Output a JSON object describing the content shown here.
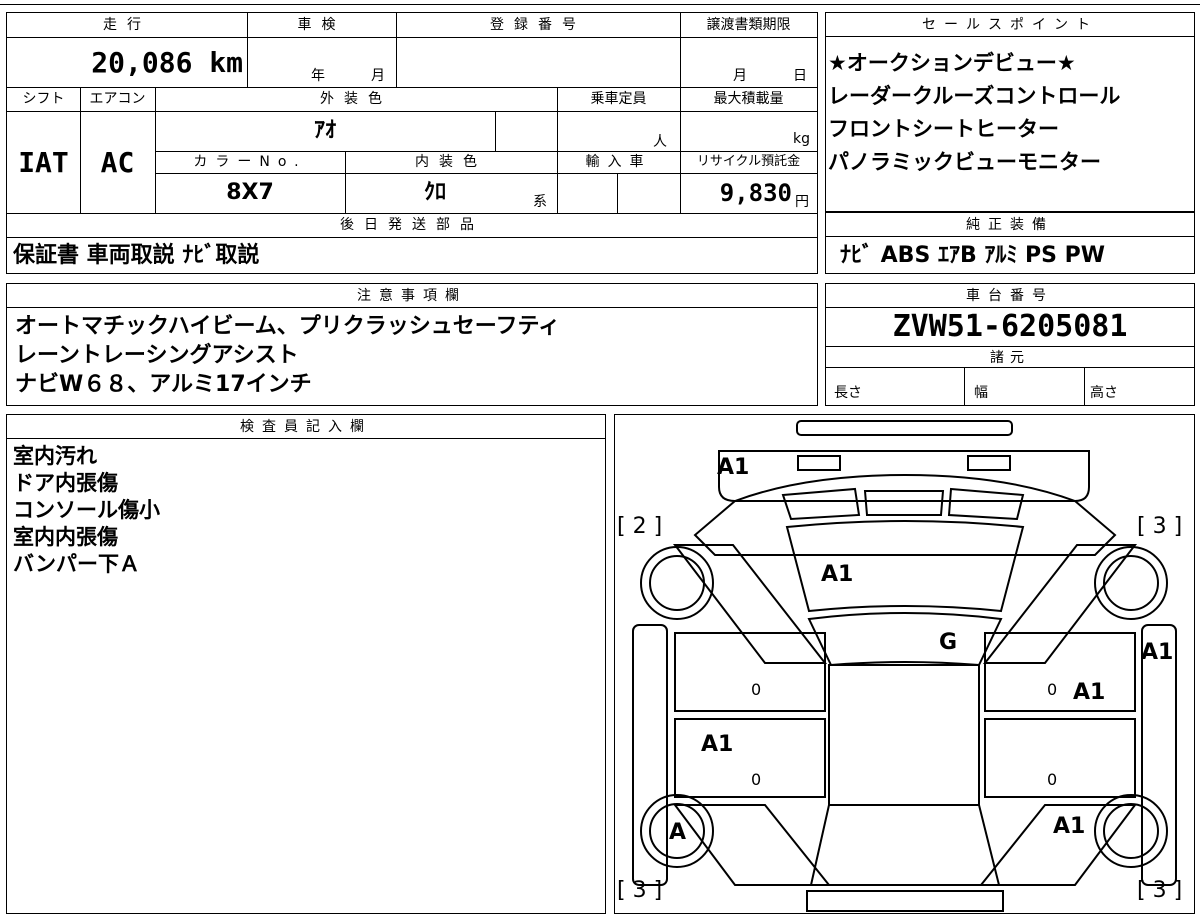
{
  "summary": {
    "mileage_label": "走行",
    "mileage_value": "20,086 km",
    "inspection_label": "車検",
    "inspection_year_unit": "年",
    "inspection_month_unit": "月",
    "registration_label": "登録番号",
    "transfer_deadline_label": "譲渡書類期限",
    "transfer_month_unit": "月",
    "transfer_day_unit": "日",
    "shift_label": "シフト",
    "shift_value": "IAT",
    "aircon_label": "エアコン",
    "aircon_value": "AC",
    "exterior_color_label": "外装色",
    "exterior_color_value": "ｱｵ",
    "capacity_label": "乗車定員",
    "capacity_unit": "人",
    "max_load_label": "最大積載量",
    "max_load_unit": "kg",
    "color_no_label": "カラーNo.",
    "color_no_value": "8X7",
    "interior_color_label": "内装色",
    "interior_color_value": "ｸﾛ",
    "interior_color_suffix": "系",
    "import_label": "輸入車",
    "recycle_label": "リサイクル預託金",
    "recycle_value": "9,830",
    "recycle_unit": "円",
    "later_parts_label": "後日発送部品",
    "later_parts_value": "保証書 車両取説 ﾅﾋﾞ取説"
  },
  "sales_points": {
    "label": "セールスポイント",
    "lines": [
      "★オークションデビュー★",
      "レーダークルーズコントロール",
      "フロントシートヒーター",
      "パノラミックビューモニター"
    ]
  },
  "equipment": {
    "label": "純正装備",
    "value": "ﾅﾋﾞ ABS ｴｱB ｱﾙﾐ PS PW"
  },
  "notes": {
    "label": "注意事項欄",
    "lines": [
      "オートマチックハイビーム、プリクラッシュセーフティ",
      "レーントレーシングアシスト",
      "ナビW６８、アルミ17インチ"
    ]
  },
  "chassis": {
    "label": "車台番号",
    "value": "ZVW51-6205081"
  },
  "specs": {
    "label": "諸元",
    "length_label": "長さ",
    "width_label": "幅",
    "height_label": "高さ"
  },
  "inspector": {
    "label": "検査員記入欄",
    "lines": [
      "室内汚れ",
      "ドア内張傷",
      "コンソール傷小",
      "室内内張傷",
      "バンパー下Ａ"
    ]
  },
  "diagram": {
    "marks": {
      "front_bumper": "A1",
      "hood": "A1",
      "windshield": "G",
      "front_left_door": "A1",
      "right_fender": "A1",
      "right_front_door": "A1",
      "right_rear": "A1",
      "left_rear_wheel": "A"
    },
    "tire_front_left": "[ 2 ]",
    "tire_front_right": "[ 3 ]",
    "tire_rear_left": "[ 3 ]",
    "tire_rear_right": "[ 3 ]",
    "zero": "0"
  }
}
